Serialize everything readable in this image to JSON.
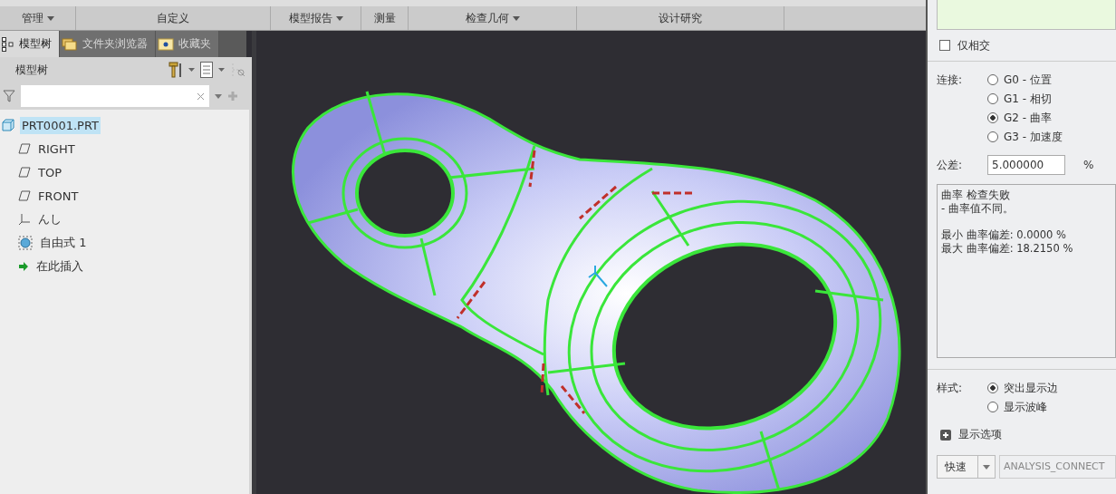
{
  "ribbon": {
    "groups": [
      {
        "label": "管理",
        "dropdown": true
      },
      {
        "label": "自定义",
        "dropdown": false
      },
      {
        "label": "模型报告",
        "dropdown": true
      },
      {
        "label": "测量",
        "dropdown": false
      },
      {
        "label": "检查几何",
        "dropdown": true
      },
      {
        "label": "设计研究",
        "dropdown": false
      }
    ]
  },
  "left_panel": {
    "tabs": [
      {
        "label": "模型树",
        "selected": true,
        "kind": "tree"
      },
      {
        "label": "文件夹浏览器",
        "selected": false,
        "kind": "folder"
      },
      {
        "label": "收藏夹",
        "selected": false,
        "kind": "favorites"
      }
    ],
    "header": "模型树",
    "tree": [
      {
        "label": "PRT0001.PRT",
        "kind": "part",
        "selected": true,
        "children": [
          {
            "label": "RIGHT",
            "kind": "plane",
            "selected": false
          },
          {
            "label": "TOP",
            "kind": "plane",
            "selected": false
          },
          {
            "label": "FRONT",
            "kind": "plane",
            "selected": false
          },
          {
            "label": "んし",
            "kind": "csys",
            "selected": false
          },
          {
            "label": "自由式 1",
            "kind": "freeform",
            "selected": false
          },
          {
            "label": "在此插入",
            "kind": "insert",
            "selected": false
          }
        ]
      }
    ]
  },
  "right_panel": {
    "intersect_only": {
      "label": "仅相交",
      "checked": false
    },
    "connection": {
      "label": "连接:",
      "options": [
        {
          "label": "G0 - 位置",
          "selected": false
        },
        {
          "label": "G1 - 相切",
          "selected": false
        },
        {
          "label": "G2 - 曲率",
          "selected": true
        },
        {
          "label": "G3 - 加速度",
          "selected": false
        }
      ]
    },
    "tolerance": {
      "label": "公差:",
      "value": "5.000000",
      "unit": "%"
    },
    "result": [
      [
        "曲率 检查失败",
        "- 曲率值不同。"
      ],
      [
        "最小 曲率偏差: 0.0000 %",
        "最大 曲率偏差: 18.2150 %"
      ]
    ],
    "style": {
      "label": "样式:",
      "options": [
        {
          "label": "突出显示边",
          "selected": true
        },
        {
          "label": "显示波峰",
          "selected": false
        }
      ]
    },
    "display_options": {
      "label": "显示选项",
      "expanded": false
    },
    "bottom": {
      "mode": "快速",
      "name": "ANALYSIS_CONNECT"
    }
  }
}
